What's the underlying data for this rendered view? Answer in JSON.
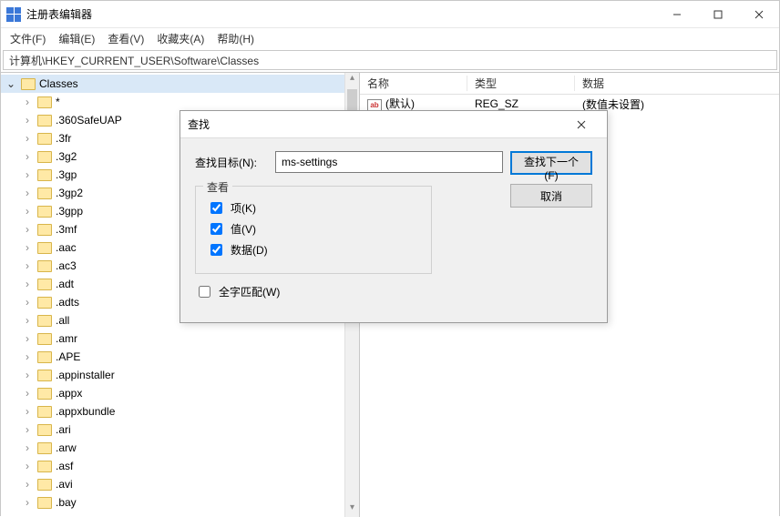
{
  "window": {
    "title": "注册表编辑器"
  },
  "menu": {
    "file": "文件(F)",
    "edit": "编辑(E)",
    "view": "查看(V)",
    "fav": "收藏夹(A)",
    "help": "帮助(H)"
  },
  "address": "计算机\\HKEY_CURRENT_USER\\Software\\Classes",
  "tree": {
    "root": "Classes",
    "items": [
      "*",
      ".360SafeUAP",
      ".3fr",
      ".3g2",
      ".3gp",
      ".3gp2",
      ".3gpp",
      ".3mf",
      ".aac",
      ".ac3",
      ".adt",
      ".adts",
      ".all",
      ".amr",
      ".APE",
      ".appinstaller",
      ".appx",
      ".appxbundle",
      ".ari",
      ".arw",
      ".asf",
      ".avi",
      ".bay"
    ]
  },
  "list": {
    "col_name": "名称",
    "col_type": "类型",
    "col_data": "数据",
    "default_name": "(默认)",
    "default_type": "REG_SZ",
    "default_data": "(数值未设置)"
  },
  "dialog": {
    "title": "查找",
    "find_label": "查找目标(N):",
    "find_value": "ms-settings",
    "group_title": "查看",
    "chk_keys": "项(K)",
    "chk_values": "值(V)",
    "chk_data": "数据(D)",
    "chk_whole": "全字匹配(W)",
    "btn_find": "查找下一个(F)",
    "btn_cancel": "取消"
  }
}
